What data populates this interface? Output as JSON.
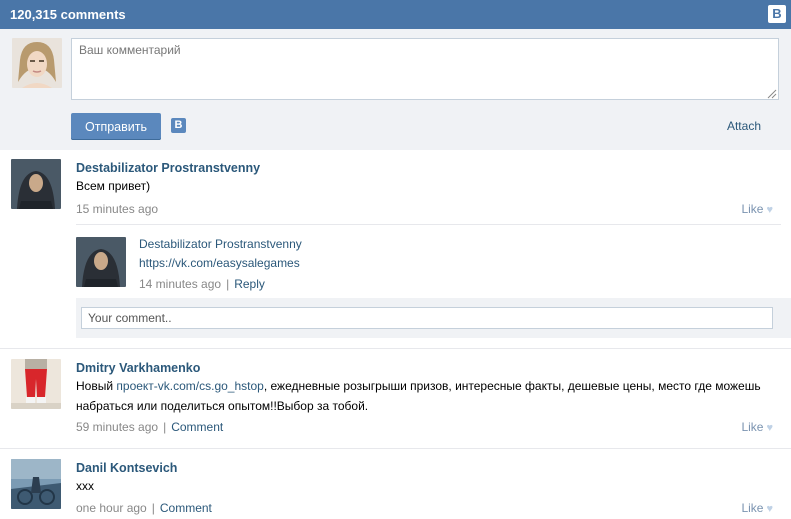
{
  "header": {
    "count": "120,315 comments",
    "badge": "B"
  },
  "composer": {
    "placeholder": "Ваш комментарий",
    "send_label": "Отправить",
    "vk_badge": "B",
    "attach_label": "Attach"
  },
  "comments": [
    {
      "name": "Destabilizator Prostranstvenny",
      "text": "Всем привет)",
      "time": "15 minutes ago",
      "like": "Like",
      "replies": [
        {
          "name": "Destabilizator Prostranstvenny",
          "text": "https://vk.com/easysalegames",
          "time": "14 minutes ago",
          "reply_label": "Reply"
        }
      ],
      "reply_placeholder": "Your comment.."
    },
    {
      "name": "Dmitry Varkhamenko",
      "text_before": "Новый ",
      "text_link": "проект-vk.com/cs.go_hstop",
      "text_after": ", ежедневные розыгрыши призов, интересные факты, дешевые цены, место где можешь",
      "text_line2": "набраться или поделиться опытом!!Выбор за тобой.",
      "time": "59 minutes ago",
      "comment_label": "Comment",
      "like": "Like"
    },
    {
      "name": "Danil Kontsevich",
      "text": "xxx",
      "time": "one hour ago",
      "comment_label": "Comment",
      "like": "Like"
    }
  ],
  "separator": "|",
  "heart": "♥"
}
